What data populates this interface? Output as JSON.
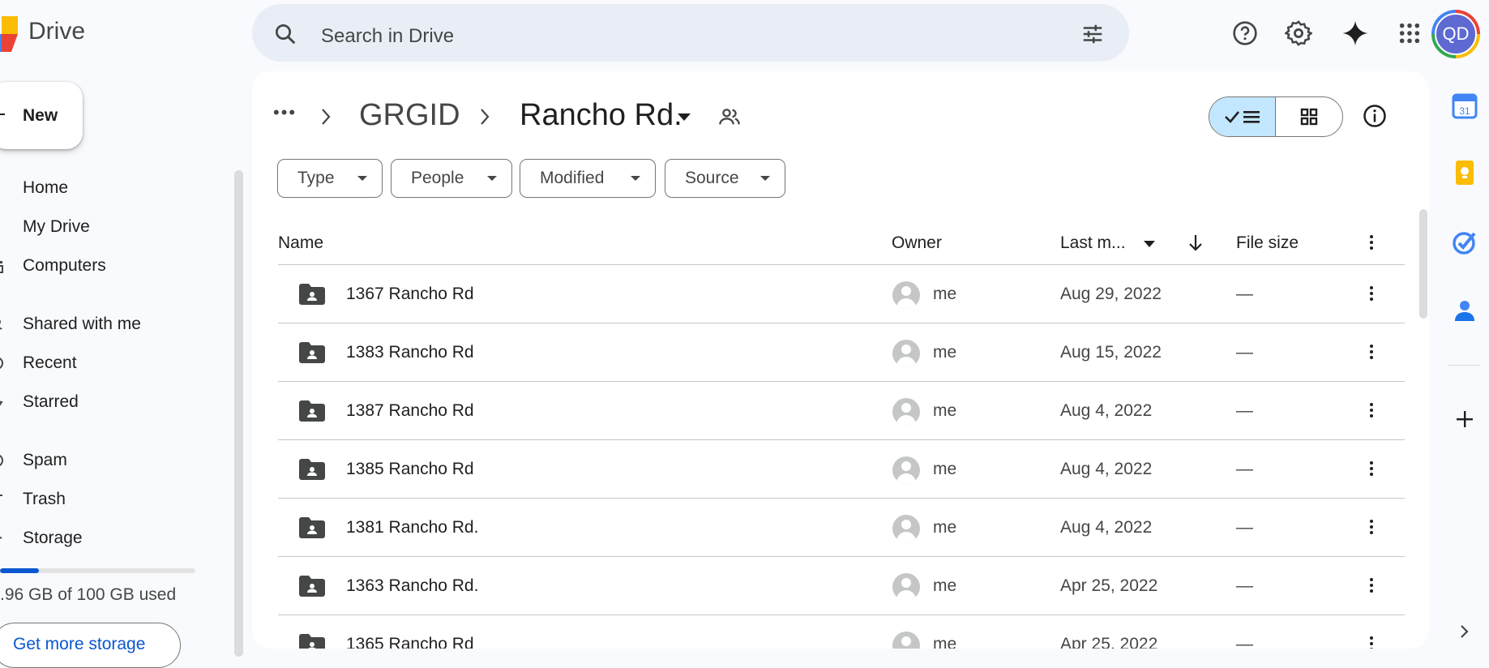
{
  "header": {
    "brand": "Drive",
    "search_placeholder": "Search in Drive",
    "avatar_initials": "QD"
  },
  "sidebar": {
    "new_label": "New",
    "items": [
      {
        "label": "Home",
        "icon": "home-icon"
      },
      {
        "label": "My Drive",
        "icon": "my-drive-icon"
      },
      {
        "label": "Computers",
        "icon": "computers-icon"
      },
      {
        "label": "Shared with me",
        "icon": "shared-icon"
      },
      {
        "label": "Recent",
        "icon": "recent-icon"
      },
      {
        "label": "Starred",
        "icon": "star-icon"
      },
      {
        "label": "Spam",
        "icon": "spam-icon"
      },
      {
        "label": "Trash",
        "icon": "trash-icon"
      },
      {
        "label": "Storage",
        "icon": "cloud-icon"
      }
    ],
    "storage_used_fraction": 0.2,
    "storage_text": ".96 GB of 100 GB used",
    "get_more_storage": "Get more storage"
  },
  "breadcrumb": {
    "more": "•••",
    "parent": "GRGID",
    "current": "Rancho Rd."
  },
  "filters": [
    "Type",
    "People",
    "Modified",
    "Source"
  ],
  "table": {
    "columns": {
      "name": "Name",
      "owner": "Owner",
      "modified": "Last m...",
      "size": "File size"
    },
    "rows": [
      {
        "name": "1367 Rancho Rd",
        "owner": "me",
        "modified": "Aug 29, 2022",
        "size": "—"
      },
      {
        "name": "1383 Rancho Rd",
        "owner": "me",
        "modified": "Aug 15, 2022",
        "size": "—"
      },
      {
        "name": "1387 Rancho Rd",
        "owner": "me",
        "modified": "Aug 4, 2022",
        "size": "—"
      },
      {
        "name": "1385 Rancho Rd",
        "owner": "me",
        "modified": "Aug 4, 2022",
        "size": "—"
      },
      {
        "name": "1381 Rancho Rd.",
        "owner": "me",
        "modified": "Aug 4, 2022",
        "size": "—"
      },
      {
        "name": "1363 Rancho Rd.",
        "owner": "me",
        "modified": "Apr 25, 2022",
        "size": "—"
      },
      {
        "name": "1365 Rancho Rd",
        "owner": "me",
        "modified": "Apr 25, 2022",
        "size": "—"
      }
    ]
  },
  "rail": {
    "calendar_day": "31"
  },
  "colors": {
    "accent": "#0b57d0",
    "toggle_on": "#c2e7ff",
    "search_bg": "#e9eef6"
  }
}
